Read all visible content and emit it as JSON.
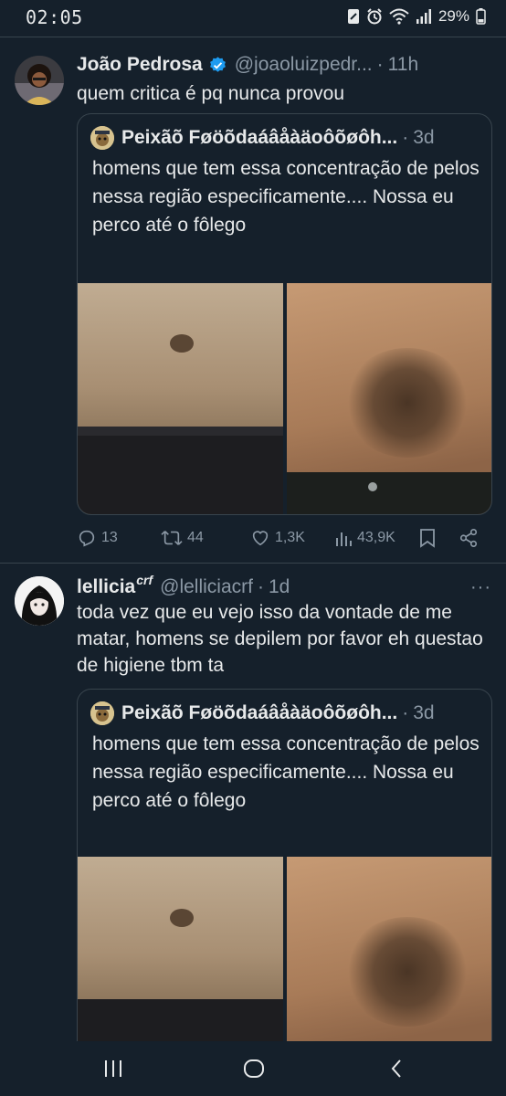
{
  "status": {
    "time": "02:05",
    "battery": "29%",
    "icons": [
      "nfc-icon",
      "alarm-icon",
      "wifi-icon",
      "signal-icon",
      "battery-icon"
    ]
  },
  "tweets": [
    {
      "name": "João Pedrosa",
      "verified": true,
      "handle": "@joaoluizpedr...",
      "time": "11h",
      "text": "quem critica é pq nunca provou",
      "quote": {
        "name": "Peixãõ Føöõdaáâåàäoôõøôh...",
        "time": "3d",
        "text": "homens que tem essa concentração de pelos nessa região especificamente.... Nossa eu perco até o fôlego"
      },
      "stats": {
        "replies": "13",
        "retweets": "44",
        "likes": "1,3K",
        "views": "43,9K"
      }
    },
    {
      "name": "lellicia",
      "name_sup": "crf",
      "handle": "@lelliciacrf",
      "time": "1d",
      "text": "toda vez que eu vejo isso da vontade de me matar, homens se depilem por favor eh questao de higiene tbm ta",
      "quote": {
        "name": "Peixãõ Føöõdaáâåàäoôõøôh...",
        "time": "3d",
        "text": "homens que tem essa concentração de pelos nessa região especificamente.... Nossa eu perco até o fôlego"
      }
    }
  ],
  "separator": "·",
  "more_label": "···",
  "colors": {
    "background": "#15202b",
    "text": "#e7e9ea",
    "muted": "#8b98a5",
    "border": "#38444d",
    "verified": "#1d9bf0"
  }
}
